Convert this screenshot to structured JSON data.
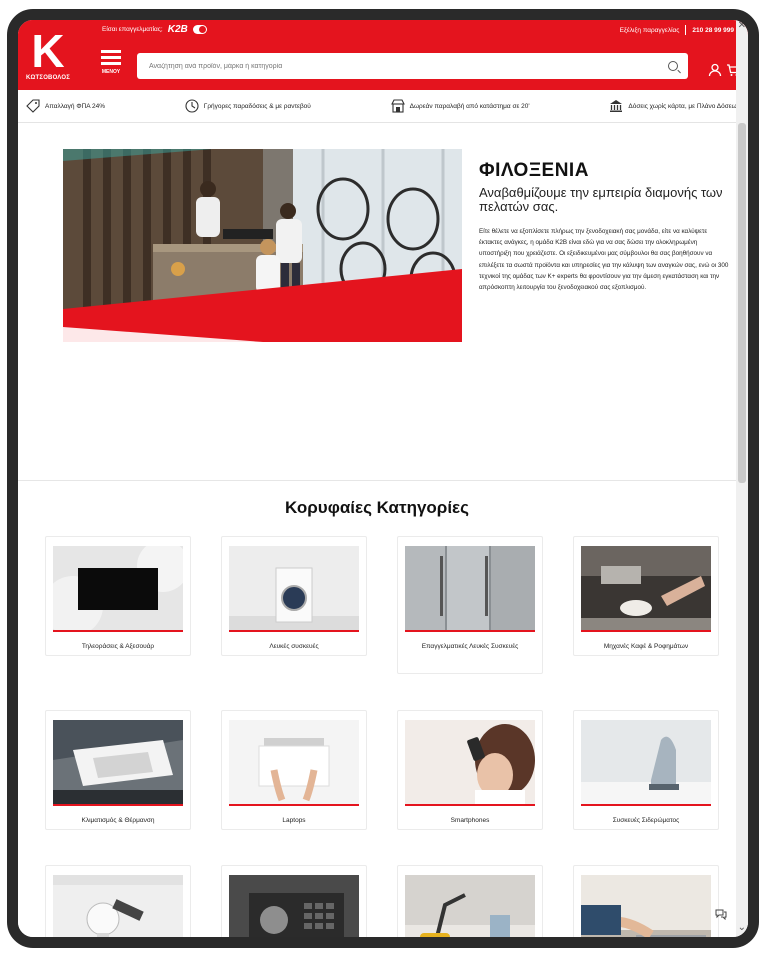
{
  "header": {
    "logo_letter": "K",
    "logo_brand": "ΚΩΤΣΟΒΟΛΟΣ",
    "business_label": "Είσαι επαγγελματίας;",
    "business_brand": "K2B",
    "menu_label": "ΜΕΝΟΥ",
    "search_placeholder": "Αναζήτηση ανά προϊόν, μάρκα ή κατηγορία",
    "top_right_label": "Εξέλιξη παραγγελίας",
    "phone": "210 28 99 999"
  },
  "benefits": [
    {
      "icon": "tag-icon",
      "label": "Απαλλαγή ΦΠΑ 24%"
    },
    {
      "icon": "clock-icon",
      "label": "Γρήγορες παραδόσεις & με ραντεβού"
    },
    {
      "icon": "store-icon",
      "label": "Δωρεάν παραλαβή από κατάστημα σε 20'"
    },
    {
      "icon": "bank-icon",
      "label": "Δόσεις χωρίς κάρτα, με Πλάνο Δόσεων"
    }
  ],
  "hero": {
    "title": "ΦΙΛΟΞΕΝΙΑ",
    "subtitle": "Αναβαθμίζουμε την εμπειρία διαμονής των πελατών σας.",
    "body": "Είτε θέλετε να εξοπλίσετε πλήρως την ξενοδοχειακή σας μονάδα, είτε να καλύψετε έκτακτες ανάγκες, η ομάδα K2B είναι εδώ για να σας δώσει την ολοκληρωμένη υποστήριξη που χρειάζεστε. Οι εξειδικευμένοι μας σύμβουλοι θα σας βοηθήσουν να επιλέξετε τα σωστά προϊόντα και υπηρεσίες για την κάλυψη των αναγκών σας, ενώ οι 300 τεχνικοί της ομάδας των K+ experts θα φροντίσουν για την άμεση εγκατάσταση και την απρόσκοπτη λειτουργία του ξενοδοχειακού σας εξοπλισμού."
  },
  "categories": {
    "heading": "Κορυφαίες Κατηγορίες",
    "items": [
      {
        "label": "Τηλεοράσεις & Αξεσουάρ"
      },
      {
        "label": "Λευκές συσκευές"
      },
      {
        "label": "Επαγγελματικές Λευκές Συσκευές"
      },
      {
        "label": "Μηχανές Καφέ & Ροφημάτων"
      },
      {
        "label": "Κλιματισμός & Θέρμανση"
      },
      {
        "label": "Laptops"
      },
      {
        "label": "Smartphones"
      },
      {
        "label": "Συσκευές Σιδερώματος"
      },
      {
        "label": ""
      },
      {
        "label": ""
      },
      {
        "label": ""
      },
      {
        "label": ""
      }
    ]
  },
  "colors": {
    "brand_red": "#e4141e"
  }
}
